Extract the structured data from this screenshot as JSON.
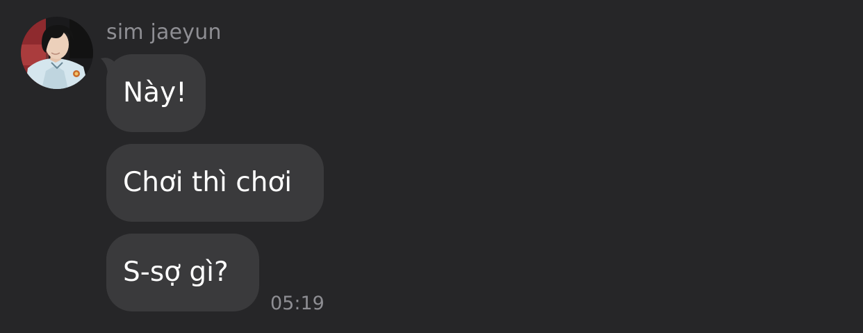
{
  "conversation": {
    "sender_name": "sim jaeyun",
    "messages": [
      {
        "text": "Này!"
      },
      {
        "text": "Chơi thì chơi"
      },
      {
        "text": "S-sợ gì?"
      }
    ],
    "last_timestamp": "05:19"
  },
  "colors": {
    "background": "#262628",
    "bubble": "#3a3a3c",
    "message_text": "#ffffff",
    "meta_text": "#8e8e93"
  },
  "icons": {
    "avatar": "profile-photo"
  }
}
